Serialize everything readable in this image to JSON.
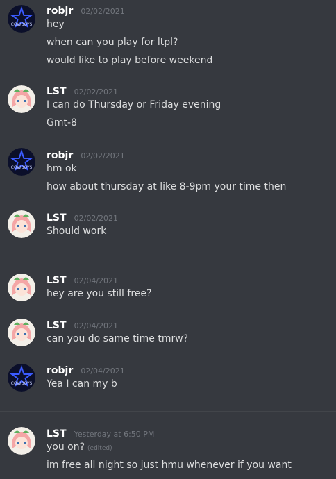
{
  "messages": [
    {
      "author": "robjr",
      "time": "02/02/2021",
      "lines": [
        "hey",
        "when can you play for ltpl?",
        "would like to play before weekend"
      ]
    },
    {
      "author": "LST",
      "time": "02/02/2021",
      "lines": [
        "I can do Thursday or Friday evening",
        "Gmt-8"
      ]
    },
    {
      "author": "robjr",
      "time": "02/02/2021",
      "lines": [
        "hm ok",
        "how about thursday at like 8-9pm your time then"
      ]
    },
    {
      "author": "LST",
      "time": "02/02/2021",
      "lines": [
        "Should work"
      ]
    },
    {
      "author": "LST",
      "time": "02/04/2021",
      "lines": [
        "hey are you still free?"
      ]
    },
    {
      "author": "LST",
      "time": "02/04/2021",
      "lines": [
        "can you do same time tmrw?"
      ]
    },
    {
      "author": "robjr",
      "time": "02/04/2021",
      "lines": [
        "Yea I can my b"
      ]
    },
    {
      "author": "LST",
      "time": "Yesterday at 6:50 PM",
      "lines": [
        "you on?",
        "im free all night so just hmu whenever if you want"
      ],
      "edited_label": "(edited)"
    }
  ],
  "avatars": {
    "robjr": {
      "icon": "cowboys-star-icon",
      "text": "COWBOYS",
      "color": "#3b5bff"
    },
    "LST": {
      "icon": "anime-avatar-icon",
      "color": "#f4a6a6"
    }
  }
}
